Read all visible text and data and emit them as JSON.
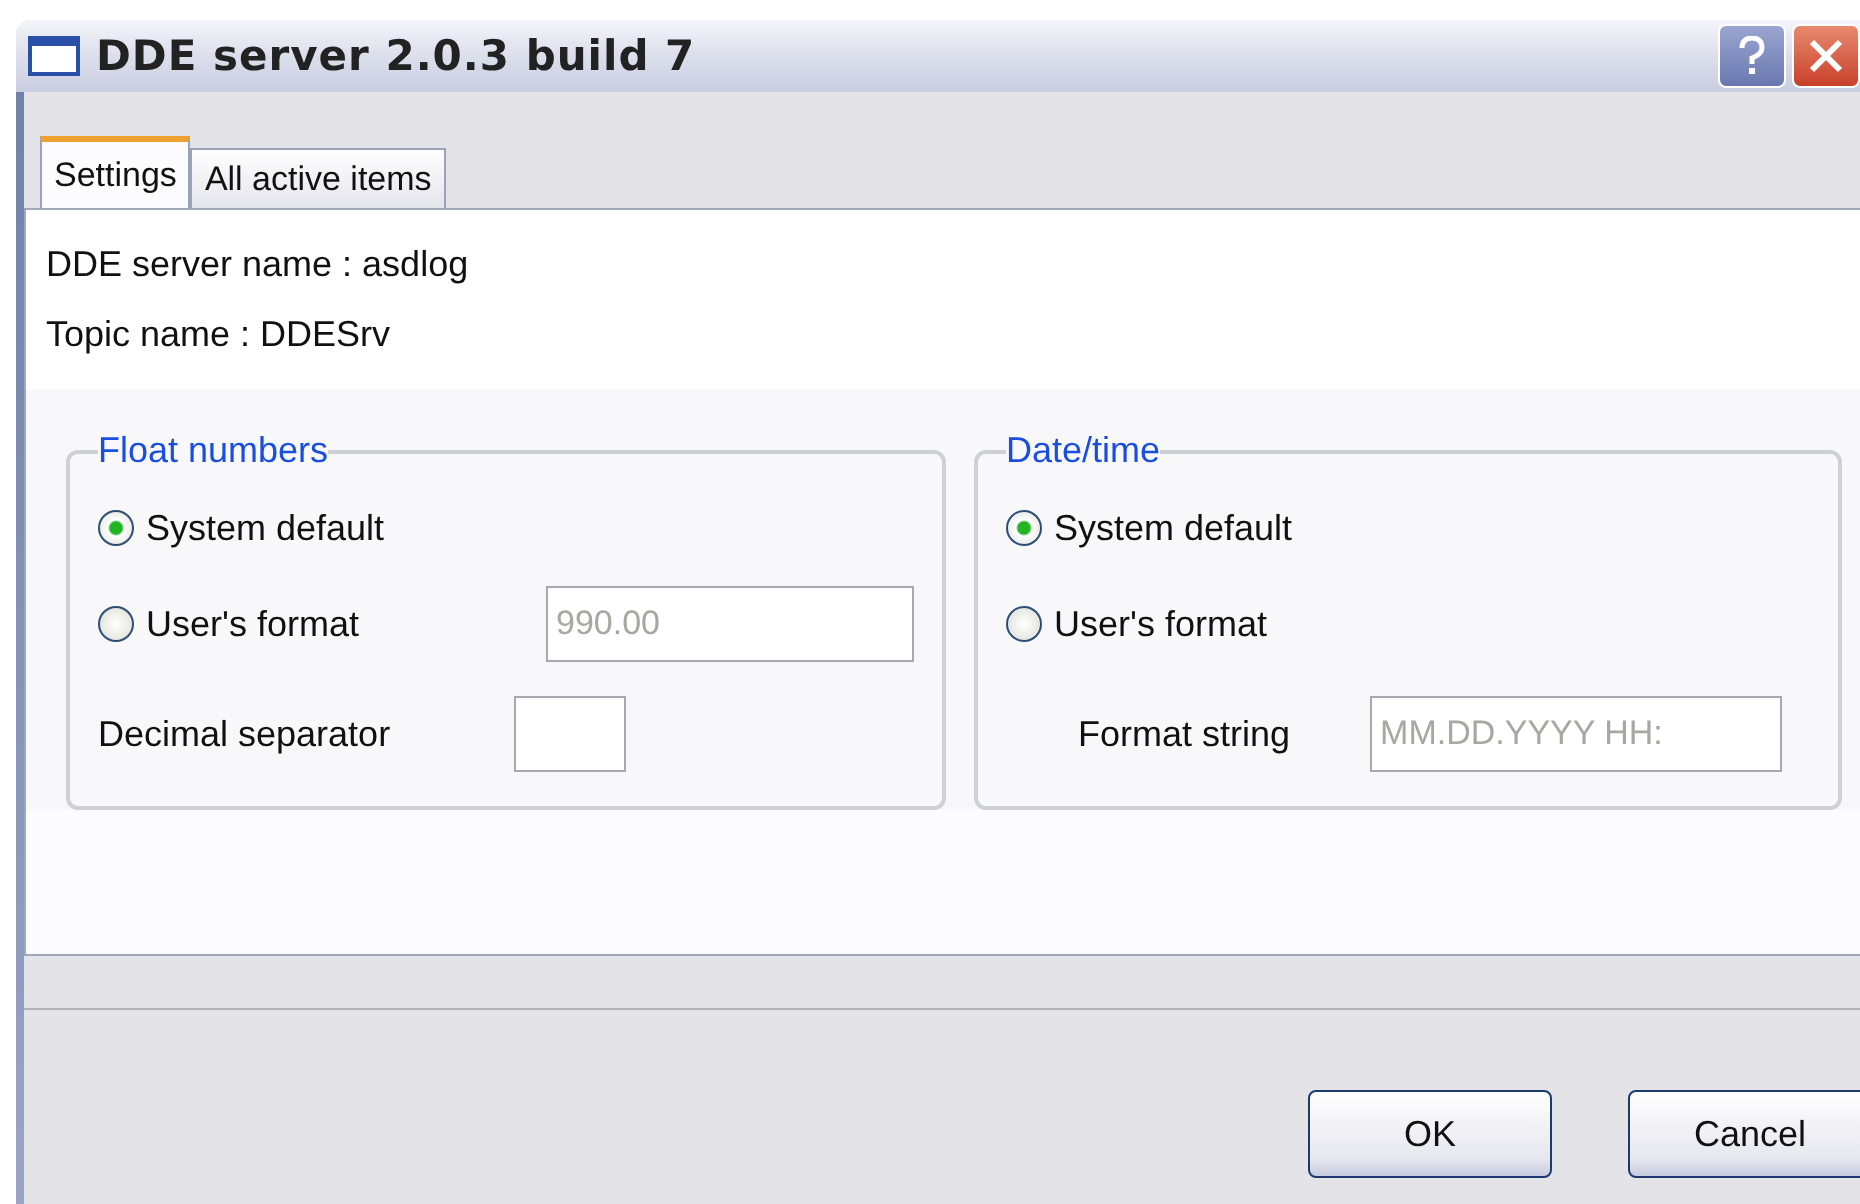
{
  "window": {
    "title": "DDE server 2.0.3 build 7"
  },
  "tabs": [
    {
      "label": "Settings",
      "selected": true
    },
    {
      "label": "All active items",
      "selected": false
    }
  ],
  "info": [
    "DDE server name : asdlog",
    "Topic name : DDESrv"
  ],
  "groups": [
    {
      "title": "Float numbers",
      "options": [
        {
          "label": "System default",
          "selected": true
        },
        {
          "label": "User's format",
          "selected": false,
          "value": "990.00"
        }
      ],
      "field": {
        "label": "Decimal separator"
      }
    },
    {
      "title": "Date/time",
      "options": [
        {
          "label": "System default",
          "selected": true
        },
        {
          "label": "User's format",
          "selected": false
        }
      ],
      "field": {
        "label": "Format string",
        "value": "MM.DD.YYYY HH:"
      }
    }
  ],
  "buttons": [
    "OK",
    "Cancel"
  ]
}
